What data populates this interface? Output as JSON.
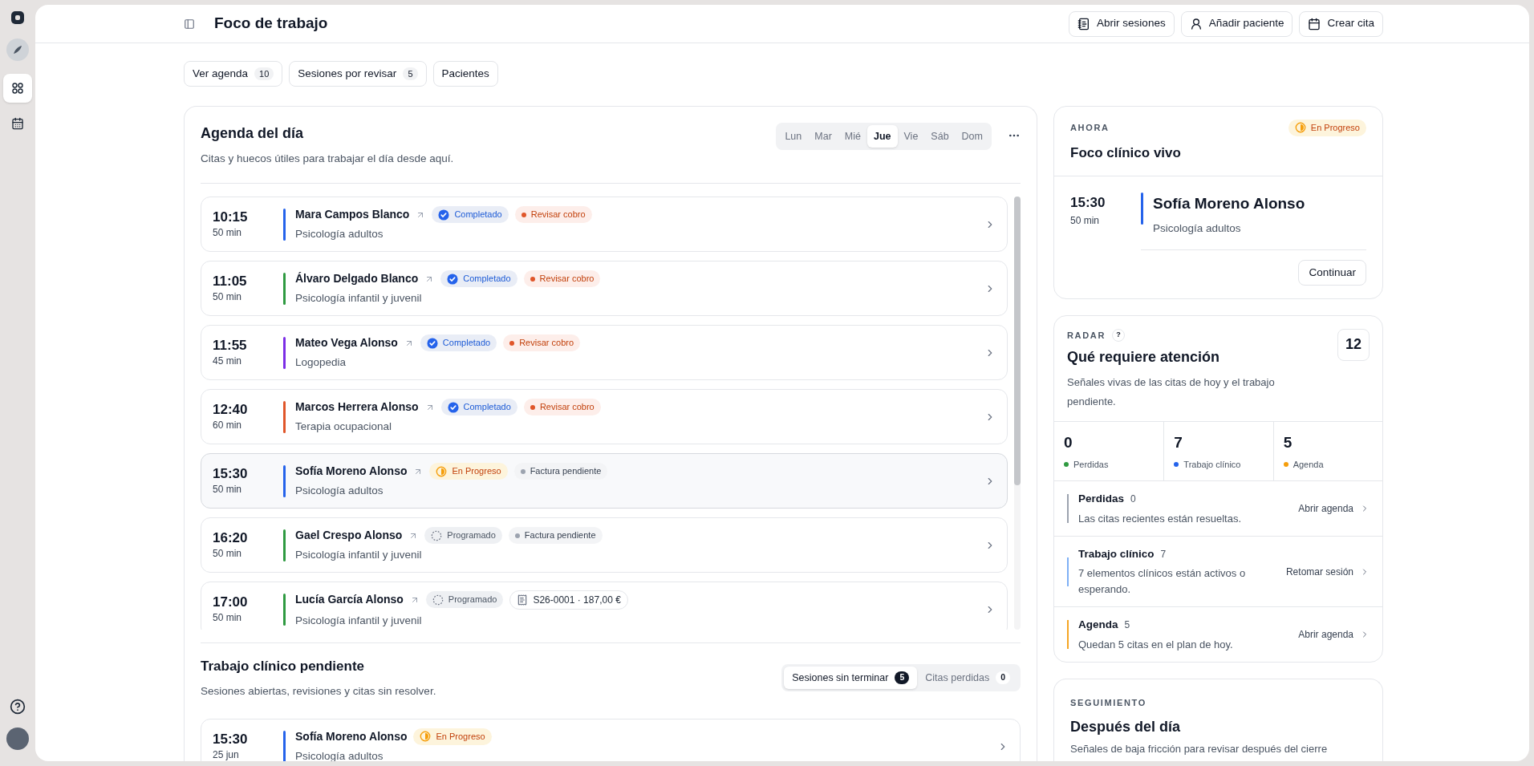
{
  "sidebar": {
    "items": [
      {
        "selected": true
      },
      {
        "selected": false
      }
    ]
  },
  "header": {
    "title": "Foco de trabajo",
    "actions": [
      {
        "label": "Abrir sesiones"
      },
      {
        "label": "Añadir paciente"
      },
      {
        "label": "Crear cita"
      }
    ]
  },
  "quick_tabs": [
    {
      "label": "Ver agenda",
      "count": "10"
    },
    {
      "label": "Sesiones por revisar",
      "count": "5"
    },
    {
      "label": "Pacientes"
    }
  ],
  "agenda": {
    "title": "Agenda del día",
    "subtitle": "Citas y huecos útiles para trabajar el día desde aquí.",
    "days": [
      {
        "label": "Lun",
        "selected": false
      },
      {
        "label": "Mar",
        "selected": false
      },
      {
        "label": "Mié",
        "selected": false
      },
      {
        "label": "Jue",
        "selected": true
      },
      {
        "label": "Vie",
        "selected": false
      },
      {
        "label": "Sáb",
        "selected": false
      },
      {
        "label": "Dom",
        "selected": false
      }
    ],
    "appointments": [
      {
        "time": "10:15",
        "duration": "50 min",
        "name": "Mara Campos Blanco",
        "service": "Psicología adultos",
        "color": "#2563eb",
        "selected": false,
        "status": {
          "kind": "completed",
          "label": "Completado"
        },
        "tag": {
          "kind": "billing",
          "label": "Revisar cobro"
        }
      },
      {
        "time": "11:05",
        "duration": "50 min",
        "name": "Álvaro Delgado Blanco",
        "service": "Psicología infantil y juvenil",
        "color": "#2f9a41",
        "selected": false,
        "status": {
          "kind": "completed",
          "label": "Completado"
        },
        "tag": {
          "kind": "billing",
          "label": "Revisar cobro"
        }
      },
      {
        "time": "11:55",
        "duration": "45 min",
        "name": "Mateo Vega Alonso",
        "service": "Logopedia",
        "color": "#7c2ee6",
        "selected": false,
        "status": {
          "kind": "completed",
          "label": "Completado"
        },
        "tag": {
          "kind": "billing",
          "label": "Revisar cobro"
        }
      },
      {
        "time": "12:40",
        "duration": "60 min",
        "name": "Marcos Herrera Alonso",
        "service": "Terapia ocupacional",
        "color": "#e0562a",
        "selected": false,
        "status": {
          "kind": "completed",
          "label": "Completado"
        },
        "tag": {
          "kind": "billing",
          "label": "Revisar cobro"
        }
      },
      {
        "time": "15:30",
        "duration": "50 min",
        "name": "Sofía Moreno Alonso",
        "service": "Psicología adultos",
        "color": "#2563eb",
        "selected": true,
        "status": {
          "kind": "in_progress",
          "label": "En Progreso"
        },
        "tag": {
          "kind": "pending",
          "label": "Factura pendiente"
        }
      },
      {
        "time": "16:20",
        "duration": "50 min",
        "name": "Gael Crespo Alonso",
        "service": "Psicología infantil y juvenil",
        "color": "#2f9a41",
        "selected": false,
        "status": {
          "kind": "scheduled",
          "label": "Programado"
        },
        "tag": {
          "kind": "pending",
          "label": "Factura pendiente"
        }
      },
      {
        "time": "17:00",
        "duration": "50 min",
        "name": "Lucía García Alonso",
        "service": "Psicología infantil y juvenil",
        "color": "#2f9a41",
        "selected": false,
        "status": {
          "kind": "scheduled",
          "label": "Programado"
        },
        "tag": {
          "kind": "invoice",
          "label": "S26-0001 · 187,00 €"
        }
      }
    ]
  },
  "pending": {
    "title": "Trabajo clínico pendiente",
    "subtitle": "Sesiones abiertas, revisiones y citas sin resolver.",
    "tabs": [
      {
        "label": "Sesiones sin terminar",
        "count": "5",
        "selected": true
      },
      {
        "label": "Citas perdidas",
        "count": "0",
        "selected": false
      }
    ],
    "items": [
      {
        "time": "15:30",
        "date": "25 jun",
        "name": "Sofía Moreno Alonso",
        "service": "Psicología adultos",
        "color": "#2563eb",
        "status": {
          "kind": "in_progress",
          "label": "En Progreso"
        }
      }
    ]
  },
  "now": {
    "eyebrow": "AHORA",
    "title": "Foco clínico vivo",
    "status": {
      "kind": "in_progress",
      "label": "En Progreso"
    },
    "time": "15:30",
    "duration": "50 min",
    "name": "Sofía Moreno Alonso",
    "service": "Psicología adultos",
    "color": "#2563eb",
    "button": "Continuar"
  },
  "radar": {
    "eyebrow": "RADAR",
    "help": "?",
    "title": "Qué requiere atención",
    "count": "12",
    "description": "Señales vivas de las citas de hoy y el trabajo pendiente.",
    "stats": [
      {
        "value": "0",
        "label": "Perdidas",
        "color": "#2f9a41"
      },
      {
        "value": "7",
        "label": "Trabajo clínico",
        "color": "#2563eb"
      },
      {
        "value": "5",
        "label": "Agenda",
        "color": "#f59e0b"
      }
    ],
    "signals": [
      {
        "title": "Perdidas",
        "count": "0",
        "description": "Las citas recientes están resueltas.",
        "action": "Abrir agenda",
        "color": "#9ca3af"
      },
      {
        "title": "Trabajo clínico",
        "count": "7",
        "description": "7 elementos clínicos están activos o esperando.",
        "action": "Retomar sesión",
        "color": "#7fb0f5"
      },
      {
        "title": "Agenda",
        "count": "5",
        "description": "Quedan 5 citas en el plan de hoy.",
        "action": "Abrir agenda",
        "color": "#f5a524"
      }
    ]
  },
  "followup": {
    "eyebrow": "SEGUIMIENTO",
    "title": "Después del día",
    "description": "Señales de baja fricción para revisar después del cierre"
  }
}
